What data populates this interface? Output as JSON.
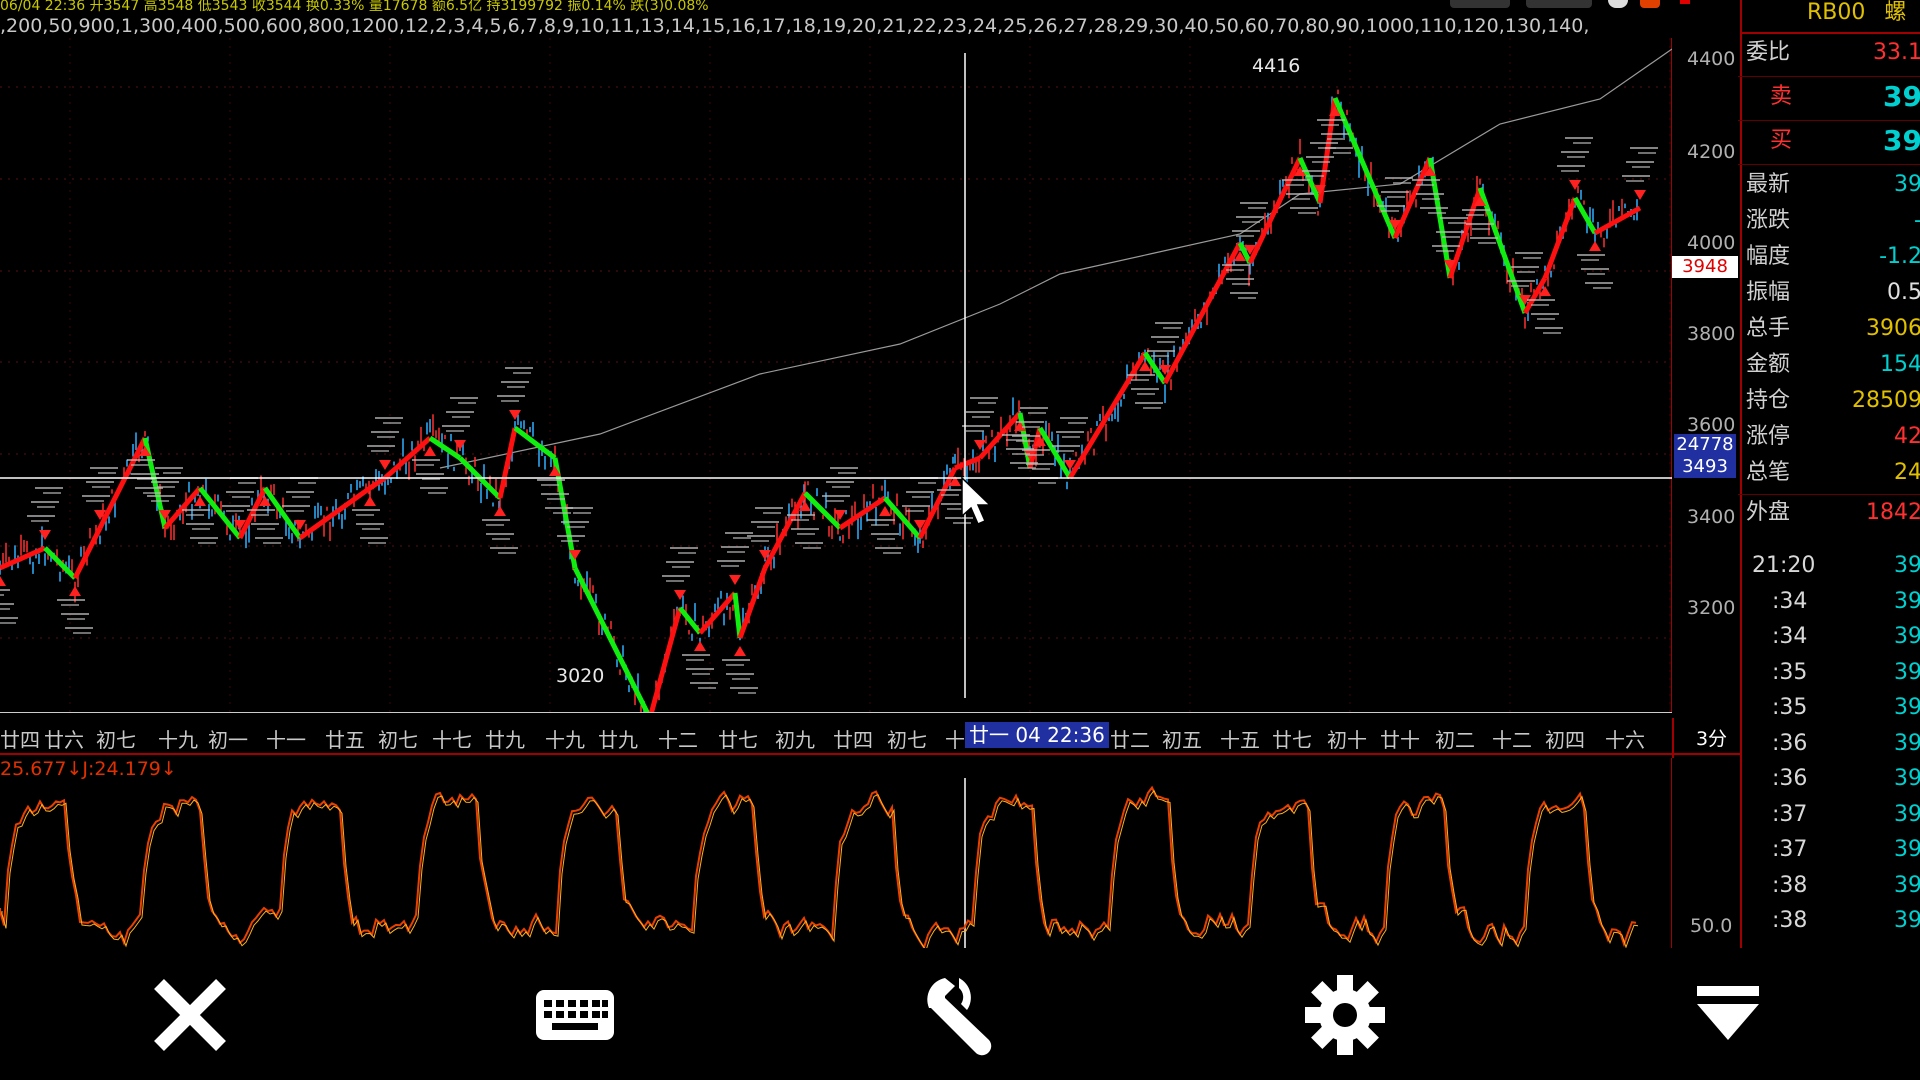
{
  "header": {
    "info_line": "06/04 22:36 开3547 高3548 低3543 收3544 换0.33% 量17678 额6.5亿 持3199792 振0.14% 跌(3)0.08%",
    "period_list": ",200,50,900,1,300,400,500,600,800,1200,12,2,3,4,5,6,7,8,9,10,11,13,14,15,16,17,18,19,20,21,22,23,24,25,26,27,28,29,30,40,50,60,70,80,90,1000,110,120,130,140,"
  },
  "main_chart": {
    "price_axis_labels": [
      "4400",
      "4200",
      "4000",
      "3800",
      "3600",
      "3400",
      "3200"
    ],
    "current_price_tag": "3948",
    "crosshair_tags": [
      "24778",
      "3493"
    ],
    "peak_label": "4416",
    "trough_label": "3020",
    "timeframe": "3分"
  },
  "date_axis": {
    "labels": [
      "廿四",
      "廿六",
      "初七",
      "十九",
      "初一",
      "十一",
      "廿五",
      "初七",
      "十七",
      "廿九",
      "十九",
      "廿九",
      "十二",
      "廿七",
      "初九",
      "廿四",
      "初七",
      "十",
      "廿二",
      "初五",
      "十五",
      "廿七",
      "初十",
      "廿十",
      "初二",
      "十二",
      "初四",
      "十六"
    ],
    "crosshair_label": "廿一 04 22:36"
  },
  "sub_chart": {
    "indicator_label": "25.677↓J:24.179↓",
    "level_label": "50.0"
  },
  "quote": {
    "symbol": "RB00",
    "symbol_suffix": "螺",
    "rows": [
      {
        "label": "委比",
        "value": "33.1",
        "color": "#ff3030"
      },
      {
        "label": "卖",
        "value": "39",
        "color": "#00d0d0"
      },
      {
        "label": "买",
        "value": "39",
        "color": "#00d0d0"
      },
      {
        "label": "最新",
        "value": "39",
        "color": "#00d0d0"
      },
      {
        "label": "涨跌",
        "value": "-",
        "color": "#00d0d0"
      },
      {
        "label": "幅度",
        "value": "-1.2",
        "color": "#00d0d0"
      },
      {
        "label": "振幅",
        "value": "0.5",
        "color": "#e0e0e0"
      },
      {
        "label": "总手",
        "value": "3906",
        "color": "#e0c000"
      },
      {
        "label": "金额",
        "value": "154",
        "color": "#00d0d0"
      },
      {
        "label": "持仓",
        "value": "28509",
        "color": "#e0c000"
      },
      {
        "label": "涨停",
        "value": "42",
        "color": "#ff3030"
      },
      {
        "label": "总笔",
        "value": "24",
        "color": "#e0c000"
      },
      {
        "label": "外盘",
        "value": "1842",
        "color": "#ff3030"
      }
    ]
  },
  "ticks": [
    {
      "time": "21:20",
      "value": "39"
    },
    {
      "time": ":34",
      "value": "39"
    },
    {
      "time": ":34",
      "value": "39"
    },
    {
      "time": ":35",
      "value": "39"
    },
    {
      "time": ":35",
      "value": "39"
    },
    {
      "time": ":36",
      "value": "39"
    },
    {
      "time": ":36",
      "value": "39"
    },
    {
      "time": ":37",
      "value": "39"
    },
    {
      "time": ":37",
      "value": "39"
    },
    {
      "time": ":38",
      "value": "39"
    },
    {
      "time": ":38",
      "value": "39"
    }
  ],
  "toolbar": {
    "buttons": [
      {
        "name": "close-icon"
      },
      {
        "name": "keyboard-icon"
      },
      {
        "name": "wrench-icon"
      },
      {
        "name": "gear-icon"
      },
      {
        "name": "collapse-down-icon"
      }
    ]
  }
}
